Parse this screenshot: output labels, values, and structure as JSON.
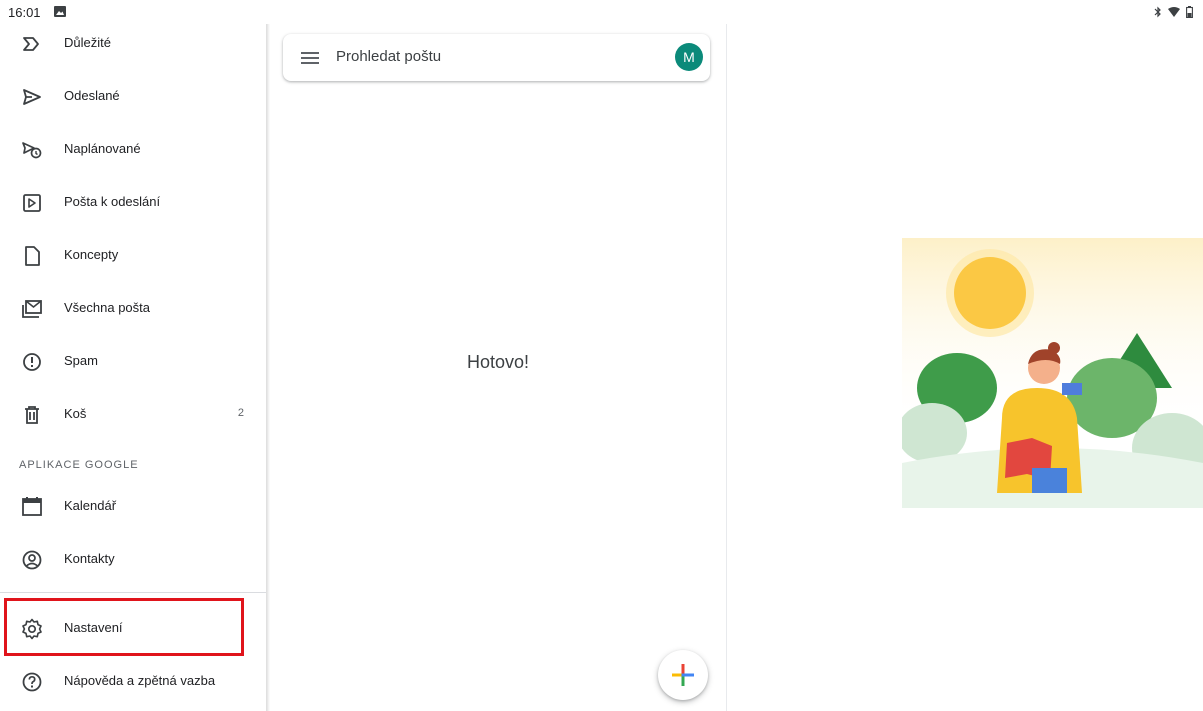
{
  "status_bar": {
    "time": "16:01"
  },
  "drawer": {
    "items": [
      {
        "label": "Důležité",
        "icon": "label-important-icon"
      },
      {
        "label": "Odeslané",
        "icon": "send-icon"
      },
      {
        "label": "Naplánované",
        "icon": "schedule-send-icon"
      },
      {
        "label": "Pošta k odeslání",
        "icon": "outbox-icon"
      },
      {
        "label": "Koncepty",
        "icon": "draft-icon"
      },
      {
        "label": "Všechna pošta",
        "icon": "all-mail-icon"
      },
      {
        "label": "Spam",
        "icon": "spam-icon"
      },
      {
        "label": "Koš",
        "icon": "trash-icon",
        "count": "2"
      }
    ],
    "section_google_apps": "APLIKACE GOOGLE",
    "apps": [
      {
        "label": "Kalendář",
        "icon": "calendar-icon"
      },
      {
        "label": "Kontakty",
        "icon": "contacts-icon"
      }
    ],
    "settings": {
      "label": "Nastavení",
      "icon": "gear-icon"
    },
    "help": {
      "label": "Nápověda a zpětná vazba",
      "icon": "help-icon"
    }
  },
  "search": {
    "placeholder": "Prohledat poštu",
    "avatar_initial": "M"
  },
  "mail_list": {
    "empty_message": "Hotovo!"
  },
  "colors": {
    "avatar": "#0b8a7a",
    "highlight": "#e0141b"
  }
}
